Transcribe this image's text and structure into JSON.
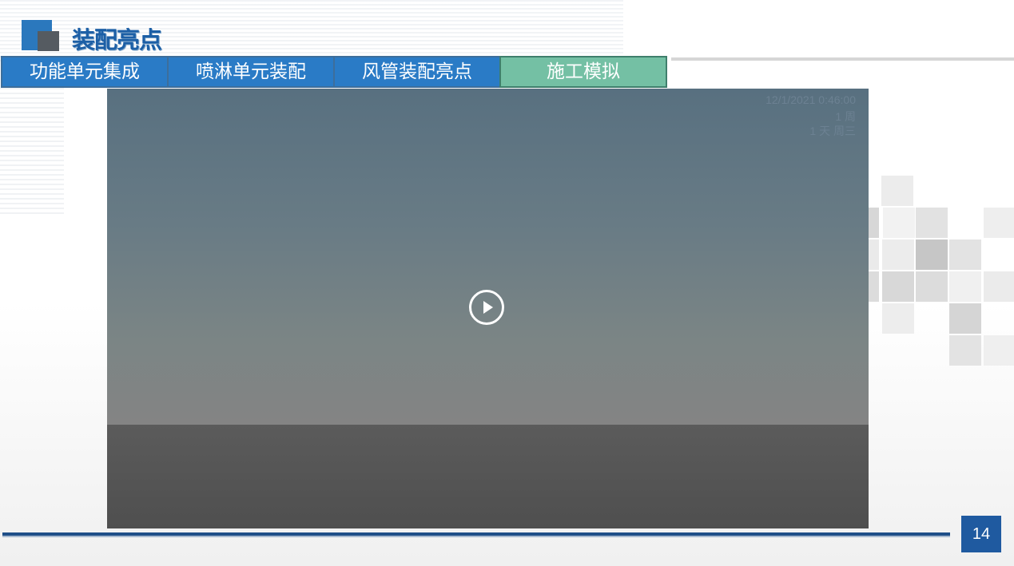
{
  "header": {
    "title": "装配亮点"
  },
  "tabs": [
    {
      "label": "功能单元集成",
      "active": false
    },
    {
      "label": "喷淋单元装配",
      "active": false
    },
    {
      "label": "风管装配亮点",
      "active": false
    },
    {
      "label": "施工模拟",
      "active": true
    }
  ],
  "video": {
    "overlay": {
      "datetime": "12/1/2021 0:46:00",
      "week": "1 周",
      "day": "1 天 周三"
    },
    "play_icon": "play-circle-icon"
  },
  "footer": {
    "page_number": "14"
  },
  "colors": {
    "accent_blue": "#2a7bc6",
    "active_tab_green": "#74c0a4",
    "title_blue": "#1c5fa6",
    "page_badge": "#1f5aa0"
  }
}
